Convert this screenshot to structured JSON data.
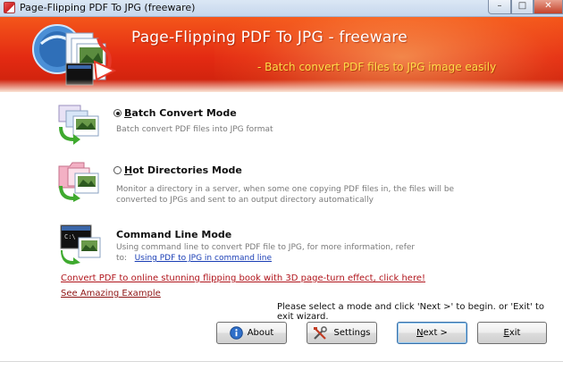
{
  "window": {
    "title": "Page-Flipping PDF To JPG (freeware)",
    "min_glyph": "–",
    "max_glyph": "□",
    "close_glyph": "✕"
  },
  "banner": {
    "title": "Page-Flipping PDF  To JPG - freeware",
    "subtitle": "- Batch convert PDF files to JPG image easily",
    "logo_icon": "pdf-to-jpg-logo-icon",
    "background_color": "#e32a12",
    "subtitle_color": "#ffde4a"
  },
  "modes": {
    "batch": {
      "accel": "B",
      "label_rest": "atch Convert Mode",
      "description": "Batch convert PDF files into JPG format",
      "selected": true,
      "icon": "batch-convert-icon"
    },
    "hot": {
      "accel": "H",
      "label_rest": "ot Directories Mode",
      "description_line1": "Monitor a directory in a server, when some one copying PDF files in, the files will be",
      "description_line2": "converted to JPGs and sent to an output directory automatically",
      "selected": false,
      "icon": "hot-directories-icon"
    },
    "cmd": {
      "label": "Command Line Mode",
      "description_line1": "Using command line to convert PDF file to JPG, for more information, refer",
      "description_prefix": "to:",
      "link_text": "Using PDF to JPG in command line",
      "icon": "command-line-icon"
    }
  },
  "links": {
    "promo": "Convert PDF to online stunning flipping book with 3D page-turn effect, click here!",
    "example": "See Amazing Example"
  },
  "instructions": "Please select a mode and click 'Next >' to begin. or 'Exit' to exit wizard.",
  "buttons": {
    "about": {
      "label": "About",
      "icon": "info-icon"
    },
    "settings": {
      "label": "Settings",
      "icon": "tools-icon"
    },
    "next": {
      "label": "Next >",
      "accel": "N",
      "label_rest": "ext >"
    },
    "exit": {
      "label": "Exit",
      "accel": "E",
      "label_rest": "xit"
    }
  },
  "colors": {
    "link_red": "#b0141b",
    "link_blue": "#1a3eb5"
  }
}
